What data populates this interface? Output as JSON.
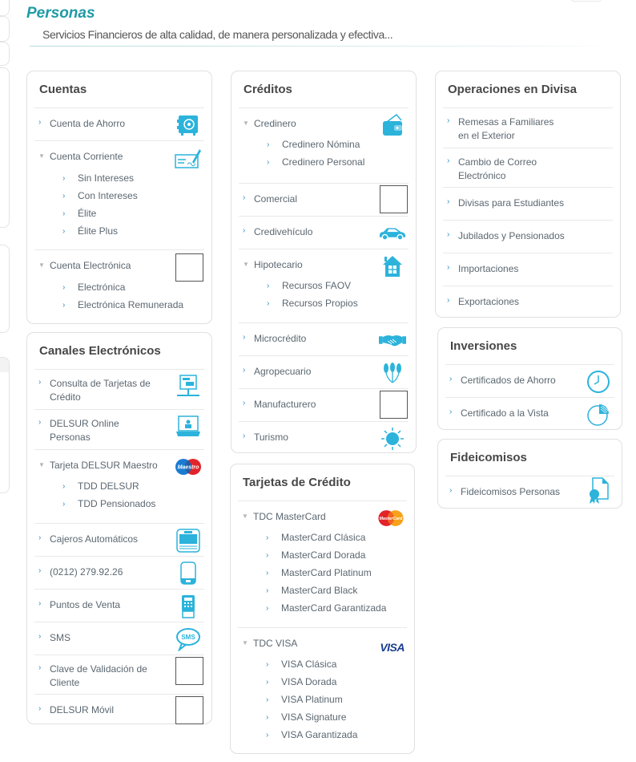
{
  "header": {
    "title": "Personas",
    "subtitle": "Servicios Financieros de alta calidad, de manera personalizada y efectiva..."
  },
  "colors": {
    "accent": "#1f9aa6",
    "icon": "#2bb3db",
    "arrow": "#2e8fc5"
  },
  "cuentas": {
    "title": "Cuentas",
    "items": [
      {
        "label": "Cuenta de Ahorro",
        "icon": "safe-icon"
      },
      {
        "label": "Cuenta Corriente",
        "icon": "check-sign-icon",
        "subitems": [
          "Sin Intereses",
          "Con Intereses",
          "Élite",
          "Élite Plus"
        ]
      },
      {
        "label": "Cuenta Electrónica",
        "icon": "placeholder-icon",
        "subitems": [
          "Electrónica",
          "Electrónica Remunerada"
        ]
      }
    ]
  },
  "canales": {
    "title": "Canales Electrónicos",
    "items": [
      {
        "label": "Consulta de Tarjetas de Crédito",
        "icon": "network-computer-icon"
      },
      {
        "label": "DELSUR Online Personas",
        "icon": "laptop-icon"
      },
      {
        "label": "Tarjeta DELSUR Maestro",
        "icon": "maestro-logo",
        "subitems": [
          "TDD DELSUR",
          "TDD Pensionados"
        ]
      },
      {
        "label": "Cajeros Automáticos",
        "icon": "atm-icon"
      },
      {
        "label": "(0212) 279.92.26",
        "icon": "phone-icon"
      },
      {
        "label": "Puntos de Venta",
        "icon": "pos-terminal-icon"
      },
      {
        "label": "SMS",
        "icon": "sms-bubble-icon"
      },
      {
        "label": "Clave de Validación de Cliente",
        "icon": "placeholder-icon"
      },
      {
        "label": "DELSUR Móvil",
        "icon": "placeholder-icon"
      }
    ]
  },
  "creditos": {
    "title": "Créditos",
    "items": [
      {
        "label": "Credinero",
        "icon": "wallet-icon",
        "subitems": [
          "Credinero Nómina",
          "Credinero Personal"
        ]
      },
      {
        "label": "Comercial",
        "icon": "placeholder-icon"
      },
      {
        "label": "Credivehículo",
        "icon": "car-icon"
      },
      {
        "label": "Hipotecario",
        "icon": "house-icon",
        "subitems": [
          "Recursos FAOV",
          "Recursos Propios"
        ]
      },
      {
        "label": "Microcrédito",
        "icon": "handshake-icon"
      },
      {
        "label": "Agropecuario",
        "icon": "wheat-icon"
      },
      {
        "label": "Manufacturero",
        "icon": "placeholder-icon"
      },
      {
        "label": "Turismo",
        "icon": "sun-icon"
      }
    ]
  },
  "tarjetas": {
    "title": "Tarjetas de Crédito",
    "items": [
      {
        "label": "TDC MasterCard",
        "icon": "mastercard-logo",
        "subitems": [
          "MasterCard Clásica",
          "MasterCard Dorada",
          "MasterCard Platinum",
          "MasterCard Black",
          "MasterCard Garantizada"
        ]
      },
      {
        "label": "TDC VISA",
        "icon": "visa-logo",
        "logo_text": "VISA",
        "subitems": [
          "VISA Clásica",
          "VISA Dorada",
          "VISA Platinum",
          "VISA Signature",
          "VISA Garantizada"
        ]
      }
    ]
  },
  "divisa": {
    "title": "Operaciones en Divisa",
    "items": [
      {
        "label_lines": [
          "Remesas a Familiares",
          "en el Exterior"
        ]
      },
      {
        "label_lines": [
          "Cambio de Correo",
          "Electrónico"
        ]
      },
      {
        "label": "Divisas para Estudiantes"
      },
      {
        "label": "Jubilados y Pensionados"
      },
      {
        "label": "Importaciones"
      },
      {
        "label": "Exportaciones"
      }
    ]
  },
  "inversiones": {
    "title": "Inversiones",
    "items": [
      {
        "label": "Certificados de Ahorro",
        "icon": "clock-icon"
      },
      {
        "label": "Certificado a la Vista",
        "icon": "pie-chart-icon"
      }
    ]
  },
  "fideicomisos": {
    "title": "Fideicomisos",
    "items": [
      {
        "label": "Fideicomisos Personas",
        "icon": "certificate-document-icon"
      }
    ]
  },
  "glyphs": {
    "arrow_right": "›",
    "arrow_down": "▼"
  }
}
